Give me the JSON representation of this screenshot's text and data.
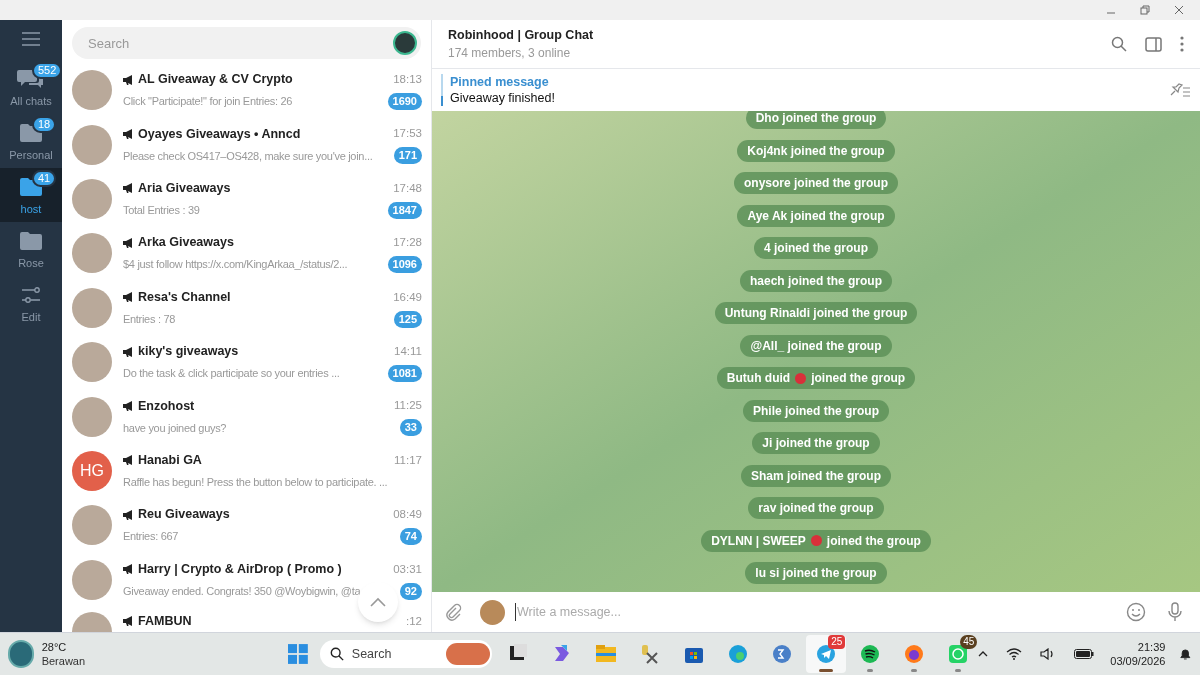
{
  "folders": [
    {
      "label": "All chats",
      "badge": "552",
      "kind": "chats",
      "selected": false
    },
    {
      "label": "Personal",
      "badge": "18",
      "kind": "folder",
      "selected": false
    },
    {
      "label": "host",
      "badge": "41",
      "kind": "folder",
      "selected": true
    },
    {
      "label": "Rose",
      "kind": "folder",
      "selected": false
    },
    {
      "label": "Edit",
      "kind": "edit",
      "selected": false
    }
  ],
  "search": {
    "placeholder": "Search"
  },
  "chats": [
    {
      "name": "AL Giveaway & CV Crypto",
      "time": "18:13",
      "preview": "Click \"Participate!\" for join    Entries: 26",
      "unread": "1690",
      "avatar": {
        "kind": "photo"
      }
    },
    {
      "name": "Oyayes Giveaways • Anncd",
      "time": "17:53",
      "preview": "Please check OS417–OS428, make sure you've join...",
      "unread": "171",
      "avatar": {
        "kind": "photo"
      }
    },
    {
      "name": "Aria Giveaways",
      "time": "17:48",
      "preview": "Total Entries : 39",
      "unread": "1847",
      "avatar": {
        "kind": "photo"
      }
    },
    {
      "name": "Arka Giveaways",
      "time": "17:28",
      "preview": "$4 just follow  https://x.com/KingArkaa_/status/2...",
      "unread": "1096",
      "avatar": {
        "kind": "photo"
      }
    },
    {
      "name": "Resa's Channel",
      "time": "16:49",
      "preview": "Entries : 78",
      "unread": "125",
      "avatar": {
        "kind": "photo"
      }
    },
    {
      "name": "kiky's giveaways",
      "time": "14:11",
      "preview": "Do the task & click participate    so your entries ...",
      "unread": "1081",
      "avatar": {
        "kind": "photo"
      }
    },
    {
      "name": "Enzohost",
      "time": "11:25",
      "preview": "have you joined guys?",
      "unread": "33",
      "avatar": {
        "kind": "photo"
      }
    },
    {
      "name": "Hanabi GA",
      "time": "11:17",
      "preview": "Raffle has begun! Press the button below to participate. ...",
      "avatar": {
        "kind": "initials",
        "initials": "HG"
      }
    },
    {
      "name": "Reu Giveaways",
      "time": "08:49",
      "preview": "Entries: 667",
      "unread": "74",
      "avatar": {
        "kind": "photo"
      }
    },
    {
      "name": "Harry | Crypto & AirDrop ( Promo )",
      "time": "03:31",
      "preview": "Giveaway ended. Congrats!  350 @Woybigwin, @ta",
      "unread": "92",
      "avatar": {
        "kind": "photo"
      }
    },
    {
      "name": "FAMBUN",
      "time": ":12",
      "avatar": {
        "kind": "photo"
      }
    }
  ],
  "chat": {
    "title": "Robinhood | Group Chat",
    "subtitle": "174 members, 3 online",
    "pinned": {
      "label": "Pinned message",
      "text": "Giveaway finished!"
    },
    "events": [
      {
        "kind": "plain",
        "text": "Dho joined the group"
      },
      {
        "kind": "plain",
        "text": "Koj4nk joined the group"
      },
      {
        "kind": "plain",
        "text": "onysore joined the group"
      },
      {
        "kind": "plain",
        "text": "Aye Ak joined the group"
      },
      {
        "kind": "plain",
        "text": "4 joined the group"
      },
      {
        "kind": "plain",
        "text": "haech joined the group"
      },
      {
        "kind": "plain",
        "text": "Untung Rinaldi joined the group"
      },
      {
        "kind": "plain",
        "text": "@All_ joined the group"
      },
      {
        "kind": "emoji",
        "text": "Butuh duid",
        "rest": "joined the group"
      },
      {
        "kind": "plain",
        "text": "Phile joined the group"
      },
      {
        "kind": "plain",
        "text": "Ji joined the group"
      },
      {
        "kind": "plain",
        "text": "Sham joined the group"
      },
      {
        "kind": "plain",
        "text": "rav joined the group"
      },
      {
        "kind": "emoji",
        "text": "DYLNN | SWEEP",
        "rest": "joined the group"
      },
      {
        "kind": "plain",
        "text": "lu si joined the group"
      }
    ],
    "composer": {
      "placeholder": "Write a message..."
    }
  },
  "taskbar": {
    "weather": {
      "temp": "28°C",
      "condition": "Berawan"
    },
    "search": {
      "placeholder": "Search"
    },
    "apps": [
      {
        "kind": "taskview"
      },
      {
        "kind": "copilot"
      },
      {
        "kind": "files"
      },
      {
        "kind": "tools"
      },
      {
        "kind": "store"
      },
      {
        "kind": "edge"
      },
      {
        "kind": "math"
      },
      {
        "kind": "telegram",
        "badge": "25",
        "selected": true
      },
      {
        "kind": "spotify",
        "selected": false
      },
      {
        "kind": "firefox",
        "selected": false
      },
      {
        "kind": "whatsapp",
        "badge": "45",
        "selected": false
      }
    ],
    "time": "21:39",
    "date": "03/09/2026"
  }
}
